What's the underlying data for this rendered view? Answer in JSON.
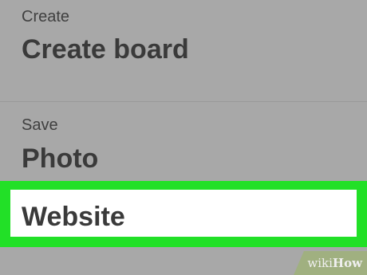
{
  "sections": [
    {
      "label": "Create",
      "items": [
        "Create board"
      ]
    },
    {
      "label": "Save",
      "items": [
        "Photo",
        "Website"
      ]
    }
  ],
  "watermark": {
    "prefix": "wiki",
    "suffix": "How"
  },
  "colors": {
    "background": "#a8a8a8",
    "highlight": "#22e027",
    "selected_item_bg": "#ffffff",
    "text": "#3a3a3a"
  }
}
